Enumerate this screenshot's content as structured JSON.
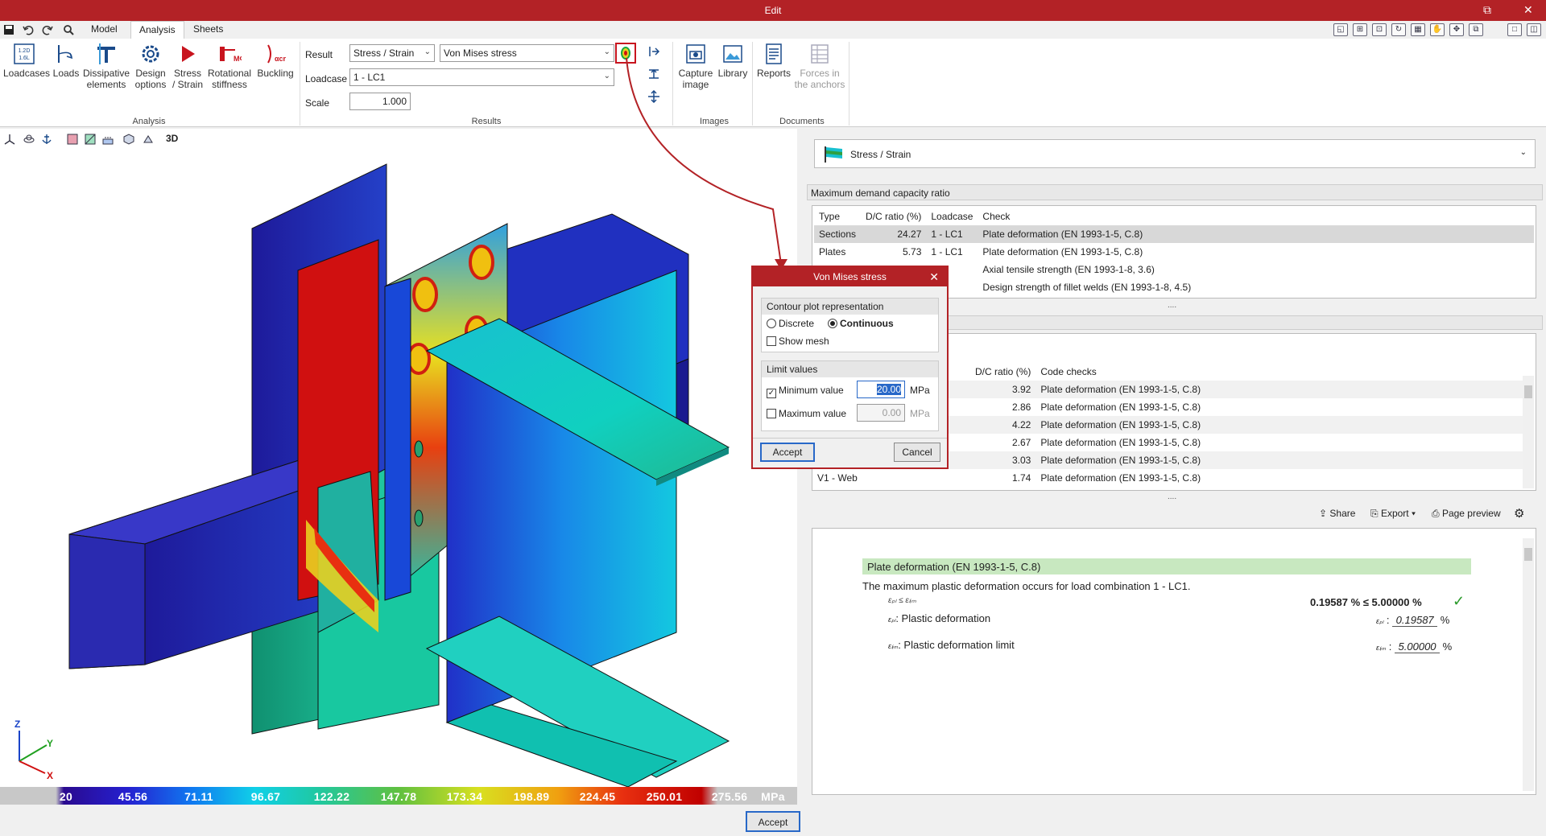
{
  "window": {
    "title": "Edit",
    "restore": "⧉",
    "close": "✕"
  },
  "tabs": [
    "Model",
    "Analysis",
    "Sheets"
  ],
  "ribbon": {
    "analysis": [
      "Loadcases",
      "Loads",
      "Dissipative elements",
      "Design options",
      "Stress / Strain",
      "Rotational stiffness",
      "Buckling"
    ],
    "analysis_group": "Analysis",
    "result_label": "Result",
    "result_value": "Stress / Strain",
    "result_sub": "Von Mises stress",
    "loadcase_label": "Loadcase",
    "loadcase_value": "1 - LC1",
    "scale_label": "Scale",
    "scale_value": "1.000",
    "results_group": "Results",
    "images": [
      "Capture image",
      "Library"
    ],
    "images_group": "Images",
    "documents": [
      "Reports",
      "Forces in the anchors"
    ],
    "documents_group": "Documents"
  },
  "legend": {
    "values": [
      "20",
      "45.56",
      "71.11",
      "96.67",
      "122.22",
      "147.78",
      "173.34",
      "198.89",
      "224.45",
      "250.01",
      "275.56"
    ],
    "unit": "MPa"
  },
  "bottom": {
    "accept": "Accept"
  },
  "panel": {
    "dropdown": "Stress / Strain",
    "max_title": "Maximum demand capacity ratio",
    "max_headers": [
      "Type",
      "D/C ratio (%)",
      "Loadcase",
      "Check"
    ],
    "max_rows": [
      [
        "Sections",
        "24.27",
        "1 - LC1",
        "Plate deformation (EN 1993-1-5, C.8)"
      ],
      [
        "Plates",
        "5.73",
        "1 - LC1",
        "Plate deformation (EN 1993-1-5, C.8)"
      ],
      [
        "",
        "",
        "C1",
        "Axial tensile strength (EN 1993-1-8, 3.6)"
      ],
      [
        "",
        "",
        "C1",
        "Design strength of fillet welds (EN 1993-1-8, 4.5)"
      ]
    ],
    "code_headers": [
      "D/C ratio (%)",
      "Code checks"
    ],
    "code_rows": [
      [
        "",
        "3.92",
        "Plate deformation (EN 1993-1-5, C.8)"
      ],
      [
        "",
        "2.86",
        "Plate deformation (EN 1993-1-5, C.8)"
      ],
      [
        "",
        "4.22",
        "Plate deformation (EN 1993-1-5, C.8)"
      ],
      [
        "",
        "2.67",
        "Plate deformation (EN 1993-1-5, C.8)"
      ],
      [
        "",
        "3.03",
        "Plate deformation (EN 1993-1-5, C.8)"
      ],
      [
        "V1 - Web",
        "1.74",
        "Plate deformation (EN 1993-1-5, C.8)"
      ]
    ],
    "share": "Share",
    "export": "Export",
    "preview": "Page preview",
    "report_title": "Plate deformation (EN 1993-1-5, C.8)",
    "report_line": "The maximum plastic deformation occurs for load combination 1 - LC1.",
    "report_result": "0.19587 % ≤ 5.00000 %",
    "report_formula": "εₚₗ ≤ εₗᵢₘ",
    "pd_label": ": Plastic deformation",
    "pd_sym": "εₚₗ",
    "pd_val": "0.19587",
    "pd_unit": "%",
    "lim_label": ": Plastic deformation limit",
    "lim_sym": "εₗᵢₘ",
    "lim_val": "5.00000",
    "lim_unit": "%"
  },
  "dialog": {
    "title": "Von Mises stress",
    "contour_title": "Contour plot representation",
    "discrete": "Discrete",
    "continuous": "Continuous",
    "show_mesh": "Show mesh",
    "limit_title": "Limit values",
    "min_label": "Minimum value",
    "min_value": "20.00",
    "min_unit": "MPa",
    "max_label": "Maximum value",
    "max_value": "0.00",
    "max_unit": "MPa",
    "accept": "Accept",
    "cancel": "Cancel"
  },
  "colors": {
    "brand": "#b32226",
    "accent": "#2868c8"
  },
  "axes": {
    "z": "Z",
    "y": "Y",
    "x": "X"
  },
  "tabs_ext": {
    "three_d": "3D"
  }
}
